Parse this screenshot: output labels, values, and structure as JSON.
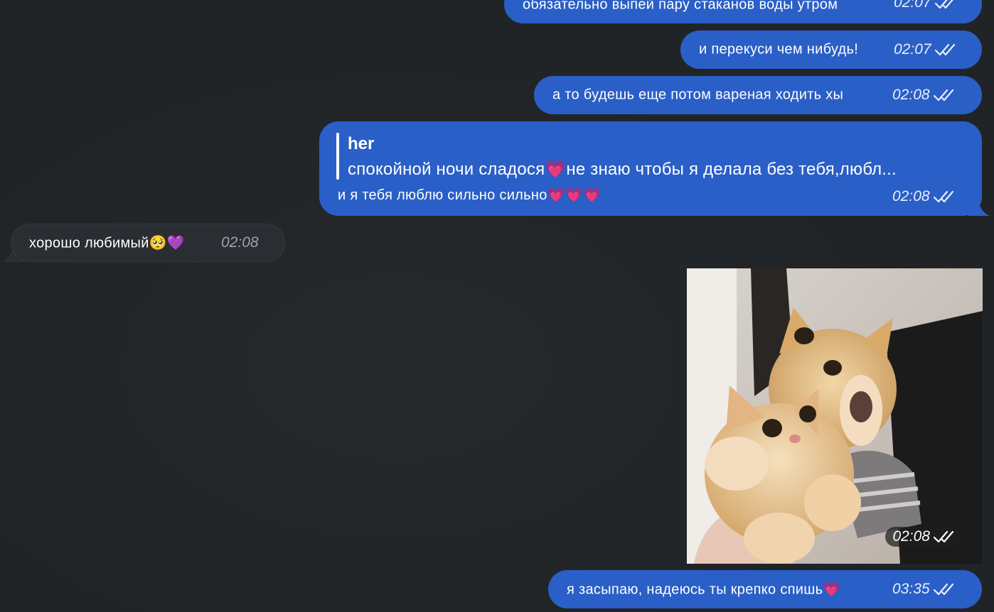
{
  "messages": [
    {
      "id": "m1",
      "direction": "out",
      "text": "обязательно выпей пару стаканов воды утром",
      "time": "02:07",
      "status": "read"
    },
    {
      "id": "m2",
      "direction": "out",
      "text": "и перекуси чем нибудь!",
      "time": "02:07",
      "status": "read"
    },
    {
      "id": "m3",
      "direction": "out",
      "text": "а то будешь еще потом вареная ходить хы",
      "time": "02:08",
      "status": "read"
    },
    {
      "id": "m4",
      "direction": "out",
      "reply_to": {
        "name": "her",
        "text": "спокойной ночи сладося💗не знаю чтобы я делала без тебя,любл..."
      },
      "text": "и я тебя люблю сильно сильно💗💗💗",
      "time": "02:08",
      "status": "read"
    },
    {
      "id": "m5",
      "direction": "in",
      "text": "хорошо любимый🥺💜",
      "time": "02:08"
    },
    {
      "id": "m6",
      "direction": "out",
      "type": "photo",
      "time": "02:08",
      "status": "read"
    },
    {
      "id": "m7",
      "direction": "out",
      "text": "я засыпаю, надеюсь ты крепко спишь💗",
      "time": "03:35",
      "status": "read"
    }
  ],
  "colors": {
    "background": "#212427",
    "outgoing_bubble": "#2a5fc7",
    "incoming_bubble": "#2a2d31"
  },
  "icons": {
    "read_status": "double-check-icon"
  }
}
